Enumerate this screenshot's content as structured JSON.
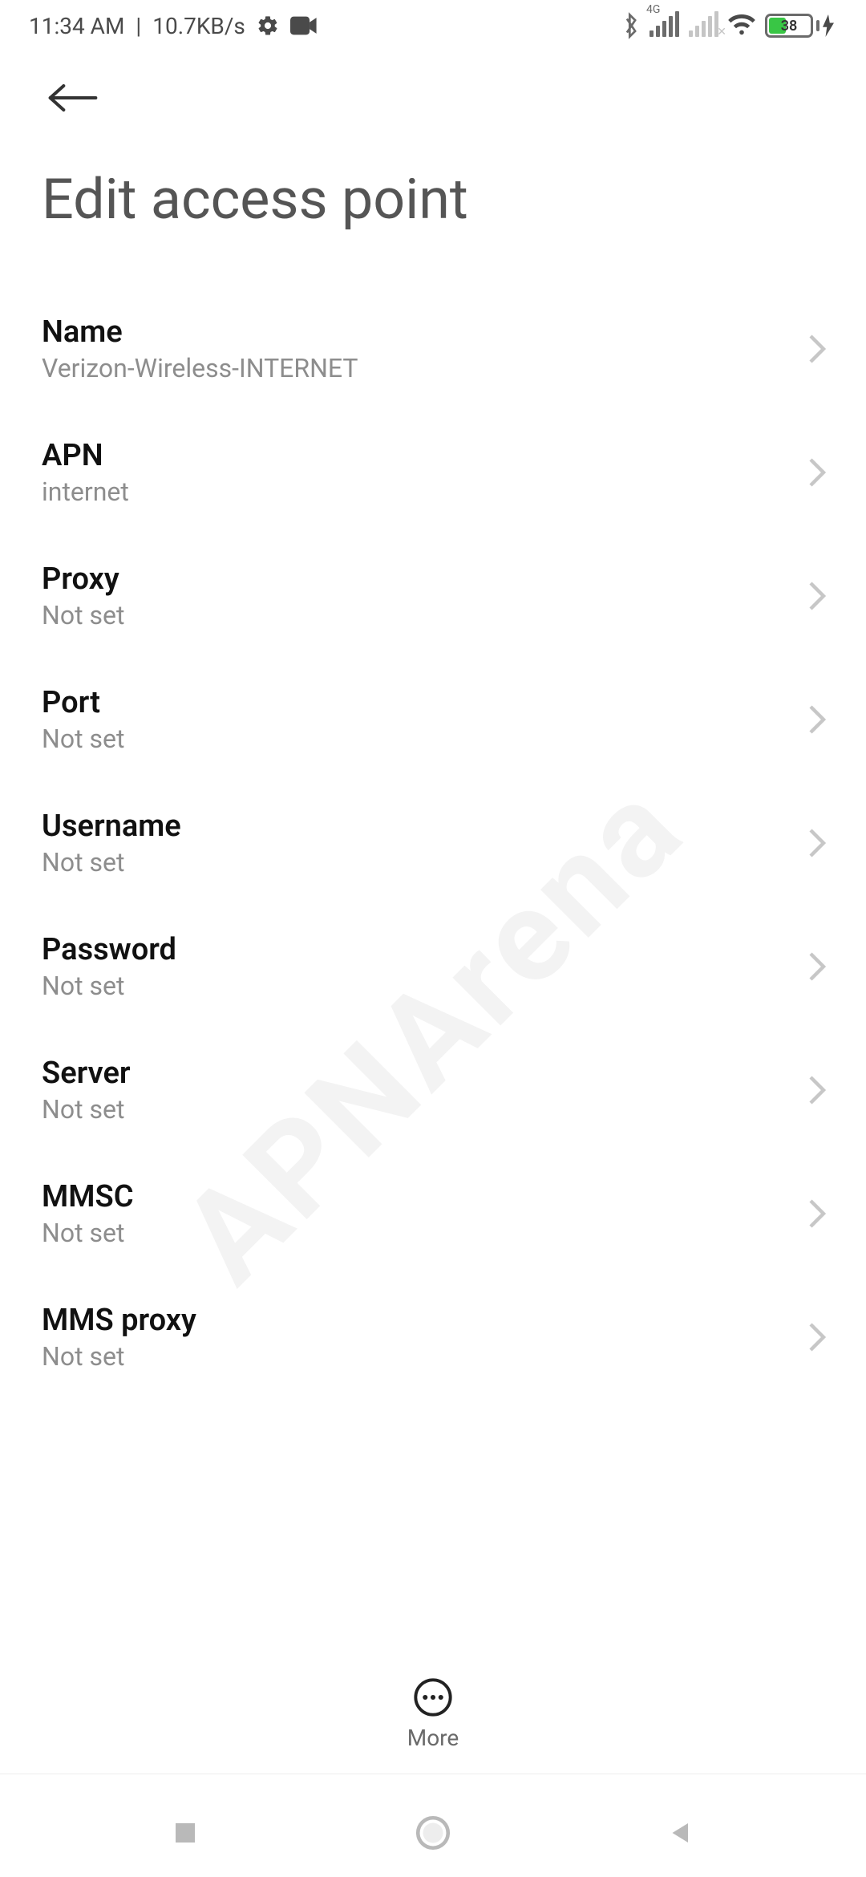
{
  "statusbar": {
    "time": "11:34 AM",
    "separator": " | ",
    "net_speed": "10.7KB/s",
    "signal_tag": "4G",
    "battery_percent": "38",
    "battery_fill_pct": 38
  },
  "header": {
    "title": "Edit access point"
  },
  "settings": [
    {
      "label": "Name",
      "value": "Verizon-Wireless-INTERNET"
    },
    {
      "label": "APN",
      "value": "internet"
    },
    {
      "label": "Proxy",
      "value": "Not set"
    },
    {
      "label": "Port",
      "value": "Not set"
    },
    {
      "label": "Username",
      "value": "Not set"
    },
    {
      "label": "Password",
      "value": "Not set"
    },
    {
      "label": "Server",
      "value": "Not set"
    },
    {
      "label": "MMSC",
      "value": "Not set"
    },
    {
      "label": "MMS proxy",
      "value": "Not set"
    }
  ],
  "actions": {
    "more_label": "More"
  },
  "watermark": "APNArena"
}
